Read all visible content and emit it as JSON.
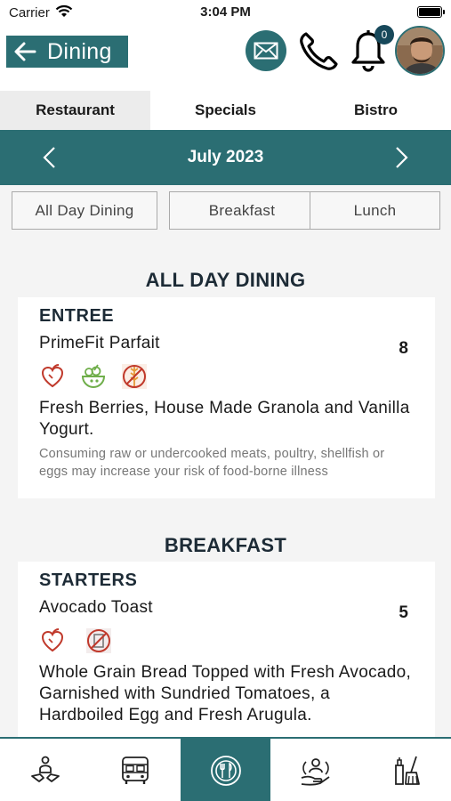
{
  "status_bar": {
    "carrier": "Carrier",
    "time": "3:04 PM"
  },
  "header": {
    "back_label": "Dining",
    "notification_count": "0"
  },
  "tabs": [
    {
      "label": "Restaurant",
      "active": true
    },
    {
      "label": "Specials",
      "active": false
    },
    {
      "label": "Bistro",
      "active": false
    }
  ],
  "month": {
    "label": "July 2023"
  },
  "filters": [
    {
      "label": "All Day Dining"
    },
    {
      "label": "Breakfast"
    },
    {
      "label": "Lunch"
    }
  ],
  "sections": [
    {
      "title": "ALL DAY DINING",
      "category": "ENTREE",
      "item": {
        "name": "PrimeFit Parfait",
        "price": "8",
        "icons": [
          "heart-healthy-icon",
          "salad-bowl-icon",
          "gluten-free-icon"
        ],
        "description": "Fresh Berries, House Made Granola and Vanilla Yogurt.",
        "disclaimer": "Consuming raw or undercooked meats, poultry, shellfish or eggs may increase your risk of food-borne illness"
      }
    },
    {
      "title": "BREAKFAST",
      "category": "STARTERS",
      "item": {
        "name": "Avocado Toast",
        "price": "5",
        "icons": [
          "heart-healthy-icon",
          "no-sugar-icon"
        ],
        "description": "Whole Grain Bread Topped with Fresh Avocado, Garnished with Sundried Tomatoes, a Hardboiled Egg and Fresh Arugula."
      }
    }
  ],
  "bottom_nav": [
    {
      "icon": "concierge-hands-icon",
      "active": false
    },
    {
      "icon": "bus-icon",
      "active": false
    },
    {
      "icon": "dining-plate-icon",
      "active": true
    },
    {
      "icon": "care-hands-icon",
      "active": false
    },
    {
      "icon": "housekeeping-icon",
      "active": false
    }
  ],
  "colors": {
    "brand": "#2b6e73",
    "badge": "#17485a",
    "icon_red": "#c0392b",
    "icon_green": "#6fae4a"
  }
}
